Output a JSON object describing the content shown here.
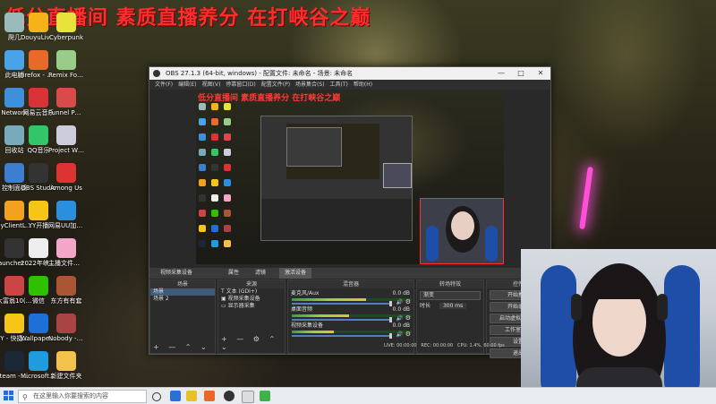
{
  "banner": "低分直播间 素质直播养分 在打峡谷之巅",
  "desktop_icons": [
    {
      "id": "recycle",
      "label": "爬几",
      "color": "#9bb"
    },
    {
      "id": "douyu",
      "label": "DouyuLive - 快捷方式",
      "color": "#f7b21a"
    },
    {
      "id": "cyberpunk",
      "label": "Cyberpunk",
      "color": "#e8e23a"
    },
    {
      "id": "computer",
      "label": "此电脑",
      "color": "#4aa3e8"
    },
    {
      "id": "firefox",
      "label": "firefox - 快捷方式",
      "color": "#e8692a"
    },
    {
      "id": "remix",
      "label": "Remix Fortune - ...",
      "color": "#9c8"
    },
    {
      "id": "network",
      "label": "Network",
      "color": "#3d8fe0"
    },
    {
      "id": "netease",
      "label": "网易云音乐",
      "color": "#d9333a"
    },
    {
      "id": "funnel",
      "label": "Funnel Party",
      "color": "#d94a4a"
    },
    {
      "id": "recycle2",
      "label": "回收站",
      "color": "#7ab"
    },
    {
      "id": "qqmusic",
      "label": "QQ音乐",
      "color": "#32c56a"
    },
    {
      "id": "winter",
      "label": "Project Winter",
      "color": "#ccd"
    },
    {
      "id": "control",
      "label": "控制面板",
      "color": "#3c7fd0"
    },
    {
      "id": "obs",
      "label": "OBS Studio",
      "color": "#333"
    },
    {
      "id": "amongus",
      "label": "Among Us",
      "color": "#d33"
    },
    {
      "id": "dyclient",
      "label": "dyClientLa... - 快捷方式",
      "color": "#f2a21e"
    },
    {
      "id": "yy",
      "label": "YY开播",
      "color": "#f5c518"
    },
    {
      "id": "uu",
      "label": "网易UU加速器",
      "color": "#2b8fe0"
    },
    {
      "id": "launcher",
      "label": "launcher - 快捷方式",
      "color": "#333"
    },
    {
      "id": "doc2022",
      "label": "2022年峡谷之巅的攻略",
      "color": "#eee"
    },
    {
      "id": "anchor",
      "label": "主播文件夹中的",
      "color": "#f4a6c8"
    },
    {
      "id": "wegame",
      "label": "大富翁10(Ancie...",
      "color": "#c44"
    },
    {
      "id": "wechat",
      "label": "微信",
      "color": "#2dc100"
    },
    {
      "id": "dongfang",
      "label": "东方有有套",
      "color": "#a53"
    },
    {
      "id": "yyshort",
      "label": "YY - 快捷方式",
      "color": "#f5c518"
    },
    {
      "id": "wallpaper",
      "label": "Wallpaper Engine ...",
      "color": "#1f6fd9"
    },
    {
      "id": "nobody",
      "label": "Nobody - The Turna...",
      "color": "#a44"
    },
    {
      "id": "steam",
      "label": "steam - 快捷方式",
      "color": "#1b2838"
    },
    {
      "id": "edge",
      "label": "Microsoft Edge",
      "color": "#1f9be0"
    },
    {
      "id": "newfolder",
      "label": "新建文件夹",
      "color": "#f3c24b"
    }
  ],
  "obs": {
    "title": "OBS 27.1.3 (64-bit, windows) - 配置文件: 未命名 - 场景: 未命名",
    "menu": [
      "文件(F)",
      "编辑(E)",
      "视图(V)",
      "停靠窗口(D)",
      "配置文件(P)",
      "场景集合(S)",
      "工具(T)",
      "帮助(H)"
    ],
    "preview_banner": "低分直播间 素质直播养分 在打峡谷之巅",
    "toolbar": {
      "source_label": "视频采集设备",
      "props": "属性",
      "filters": "滤镜",
      "device": "激活设备"
    },
    "scenes": {
      "header": "场景",
      "items": [
        "场景",
        "场景 2"
      ]
    },
    "sources": {
      "header": "来源",
      "items": [
        "文本 (GDI+)",
        "视频采集设备",
        "显示器采集"
      ]
    },
    "mixer": {
      "header": "混音器",
      "channels": [
        {
          "name": "麦克风/Aux",
          "db": "0.0 dB",
          "level": 0.62
        },
        {
          "name": "桌面音频",
          "db": "0.0 dB",
          "level": 0.48
        },
        {
          "name": "视频采集设备",
          "db": "0.0 dB",
          "level": 0.35
        }
      ]
    },
    "transitions": {
      "header": "转场特效",
      "type": "渐变",
      "duration_label": "时长",
      "duration": "300 ms"
    },
    "controls": {
      "header": "控件",
      "buttons": [
        "开始推流",
        "开始录制",
        "启动虚拟摄像机",
        "工作室模式",
        "设置",
        "退出"
      ]
    },
    "status": {
      "live": "LIVE: 00:00:00",
      "rec": "REC: 00:00:00",
      "cpu": "CPU: 1.4%, 60.00 fps"
    }
  },
  "taskbar": {
    "search_placeholder": "在这里输入你要搜索的内容"
  },
  "colors": {
    "banner_red": "#ff2d2d",
    "obs_bg": "#292929",
    "chair_blue": "#1f4ea8"
  }
}
